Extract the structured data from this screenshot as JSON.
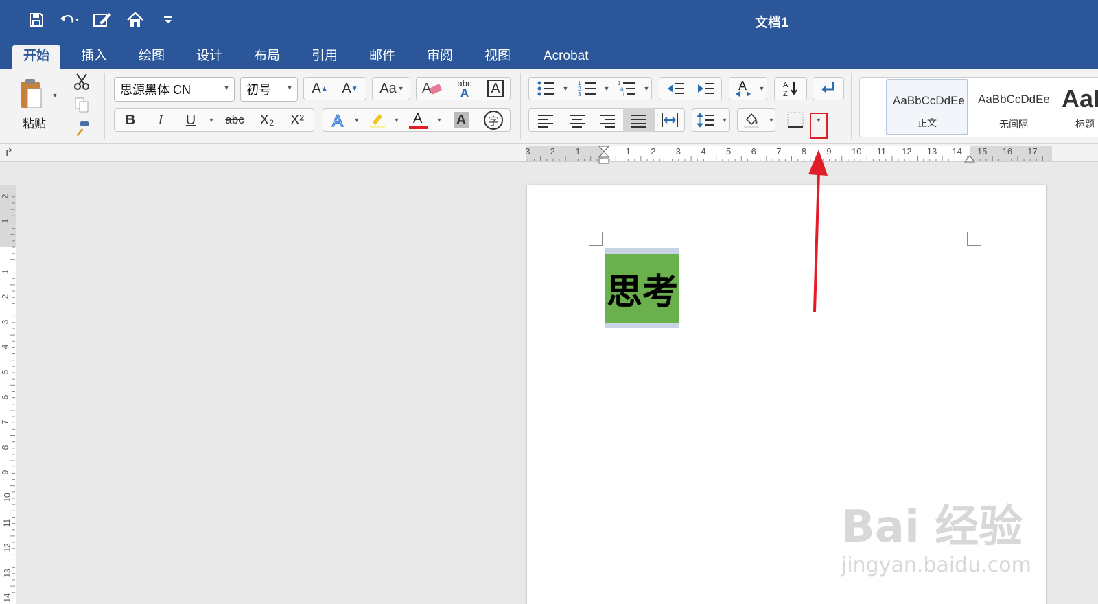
{
  "window": {
    "doc_title": "文档1"
  },
  "qat": {
    "icons": [
      "save-icon",
      "undo-icon",
      "edit-doc-icon",
      "home-icon",
      "customize-icon"
    ]
  },
  "tabs": [
    {
      "label": "开始",
      "active": true
    },
    {
      "label": "插入"
    },
    {
      "label": "绘图"
    },
    {
      "label": "设计"
    },
    {
      "label": "布局"
    },
    {
      "label": "引用"
    },
    {
      "label": "邮件"
    },
    {
      "label": "审阅"
    },
    {
      "label": "视图"
    },
    {
      "label": "Acrobat"
    }
  ],
  "clipboard": {
    "paste_label": "粘贴"
  },
  "font": {
    "name": "思源黑体 CN",
    "size": "初号"
  },
  "format_labels": {
    "bold": "B",
    "italic": "I",
    "underline": "U",
    "strike": "abc",
    "sub": "X₂",
    "sup": "X²",
    "aa": "Aa",
    "abc": "abc",
    "char_border": "A",
    "char_shade": "A",
    "phonetic": "字"
  },
  "styles": [
    {
      "sample": "AaBbCcDdEe",
      "name": "正文"
    },
    {
      "sample": "AaBbCcDdEe",
      "name": "无间隔"
    },
    {
      "sample": "AaI",
      "name": "标题"
    }
  ],
  "hruler_numbers": [
    "3",
    "2",
    "1",
    "1",
    "2",
    "3",
    "4",
    "5",
    "6",
    "7",
    "8",
    "9",
    "10",
    "11",
    "12",
    "13",
    "14",
    "15",
    "16",
    "17"
  ],
  "vruler_numbers": [
    "2",
    "1",
    "1",
    "2",
    "3",
    "4",
    "5",
    "6",
    "7",
    "8",
    "9",
    "10",
    "11",
    "12",
    "13",
    "14"
  ],
  "document": {
    "text": "思考"
  },
  "watermark": {
    "line1": "Bai 经验",
    "line2": "jingyan.baidu.com"
  },
  "colors": {
    "title_bar": "#2b579a",
    "highlight_green": "#6ab04c",
    "annotation_red": "#e11d2a"
  }
}
